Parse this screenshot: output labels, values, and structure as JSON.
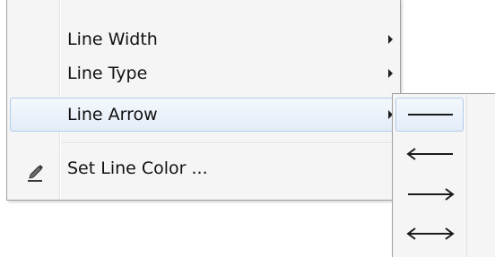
{
  "context_menu": {
    "items": [
      {
        "label": "Line Width",
        "has_submenu": true
      },
      {
        "label": "Line Type",
        "has_submenu": true
      },
      {
        "label": "Line Arrow",
        "has_submenu": true,
        "highlighted": true
      },
      {
        "label": "Set Line Color ...",
        "icon": "pencil-icon",
        "has_submenu": false
      }
    ]
  },
  "line_arrow_submenu": {
    "items": [
      {
        "icon": "no-arrow-line-icon",
        "highlighted": true
      },
      {
        "icon": "left-arrow-line-icon"
      },
      {
        "icon": "right-arrow-line-icon"
      },
      {
        "icon": "both-arrows-line-icon"
      }
    ]
  },
  "colors": {
    "menu_background": "#f5f5f5",
    "menu_border": "#9f9f9f",
    "highlight_border": "#b3cdea",
    "highlight_fill": "#e3ecf8",
    "text": "#111111"
  }
}
